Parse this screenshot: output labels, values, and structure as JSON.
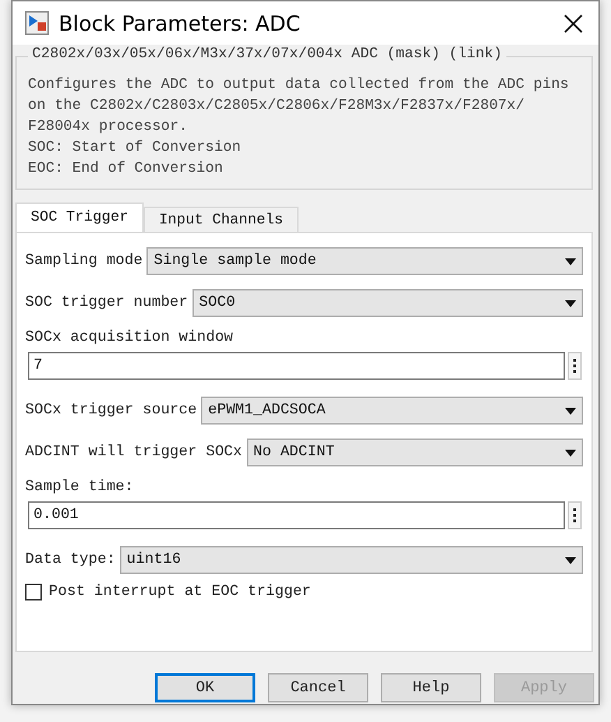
{
  "window": {
    "title": "Block Parameters: ADC"
  },
  "group": {
    "title": "C2802x/03x/05x/06x/M3x/37x/07x/004x ADC (mask) (link)",
    "description": [
      "Configures the ADC to output data collected from the ADC pins on the C2802x/C2803x/C2805x/C2806x/F28M3x/F2837x/F2807x/ F28004x processor.",
      "SOC: Start of Conversion",
      "EOC: End of Conversion"
    ]
  },
  "tabs": [
    {
      "label": "SOC Trigger",
      "selected": true
    },
    {
      "label": "Input Channels",
      "selected": false
    }
  ],
  "params": [
    {
      "kind": "select",
      "label": "Sampling mode",
      "value": "Single sample mode"
    },
    {
      "kind": "select",
      "label": "SOC trigger number",
      "value": "SOC0"
    },
    {
      "kind": "edit",
      "label": "SOCx acquisition window",
      "value": "7"
    },
    {
      "kind": "select",
      "label": "SOCx trigger source",
      "value": "ePWM1_ADCSOCA"
    },
    {
      "kind": "select",
      "label": "ADCINT will trigger SOCx",
      "value": "No ADCINT"
    },
    {
      "kind": "edit",
      "label": "Sample time:",
      "value": "0.001"
    },
    {
      "kind": "select",
      "label": "Data type:",
      "value": "uint16"
    },
    {
      "kind": "check",
      "label": "Post interrupt at EOC trigger",
      "checked": false
    }
  ],
  "buttons": [
    {
      "label": "OK",
      "focused": true,
      "disabled": false
    },
    {
      "label": "Cancel",
      "focused": false,
      "disabled": false
    },
    {
      "label": "Help",
      "focused": false,
      "disabled": false
    },
    {
      "label": "Apply",
      "focused": false,
      "disabled": true
    }
  ]
}
